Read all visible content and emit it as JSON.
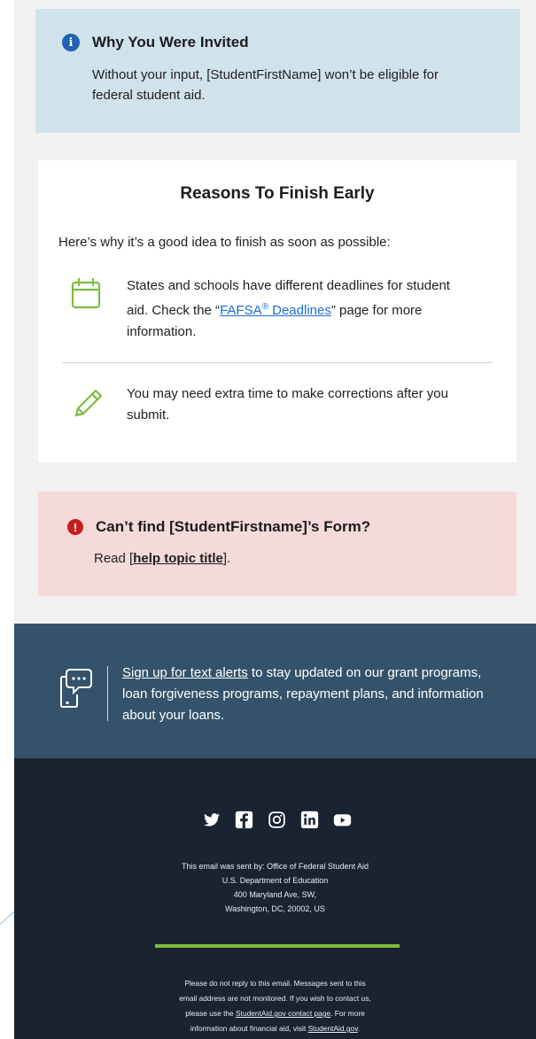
{
  "invited": {
    "icon": "info-icon",
    "title": "Why You Were Invited",
    "body": "Without your input, [StudentFirstName] won’t be eligible for federal student aid."
  },
  "reasons": {
    "title": "Reasons To Finish Early",
    "intro": "Here’s why it’s a good idea to finish as soon as possible:",
    "items": [
      {
        "icon": "calendar-icon",
        "text_before": "States and schools have different deadlines for student aid. Check the “",
        "link": "FAFSA",
        "link_sup": "®",
        "link_after": " Deadlines",
        "text_after": "” page for more information."
      },
      {
        "icon": "pencil-icon",
        "text": "You may need extra time to make corrections after you submit."
      }
    ]
  },
  "cantfind": {
    "icon": "alert-icon",
    "title": "Can’t find [StudentFirstname]’s Form?",
    "read_prefix": "Read [",
    "link": "help topic title",
    "read_suffix": "]."
  },
  "text_alerts": {
    "icon": "phone-chat-icon",
    "link": "Sign up for text alerts",
    "text": " to stay updated on our grant programs, loan forgiveness programs, repayment plans, and information about your loans."
  },
  "footer": {
    "social_icons": [
      "twitter-icon",
      "facebook-icon",
      "instagram-icon",
      "linkedin-icon",
      "youtube-icon"
    ],
    "sent_by": [
      "This email was sent by: Office of Federal Student Aid",
      "U.S. Department of Education",
      "400 Maryland Ave, SW,",
      "Washington, DC, 20002, US"
    ],
    "noreply_line1": "Please do not reply to this email. Messages sent to this",
    "noreply_line2": "email address are not monitored. If you wish to contact us,",
    "noreply_line3_before": "please use the ",
    "noreply_line3_link": "StudentAid.gov contact page",
    "noreply_line3_after": ". For more",
    "noreply_line4_before": "information about financial aid, visit ",
    "noreply_line4_link": "StudentAid.gov",
    "noreply_line4_after": "."
  },
  "colors": {
    "invited_bg": "#d0e2ea",
    "alert_bg": "#f5dada",
    "alerts_band": "#34536a",
    "footer_bg": "#1a2430",
    "accent_green": "#7bbd3f",
    "link_blue": "#1a6fd1"
  }
}
